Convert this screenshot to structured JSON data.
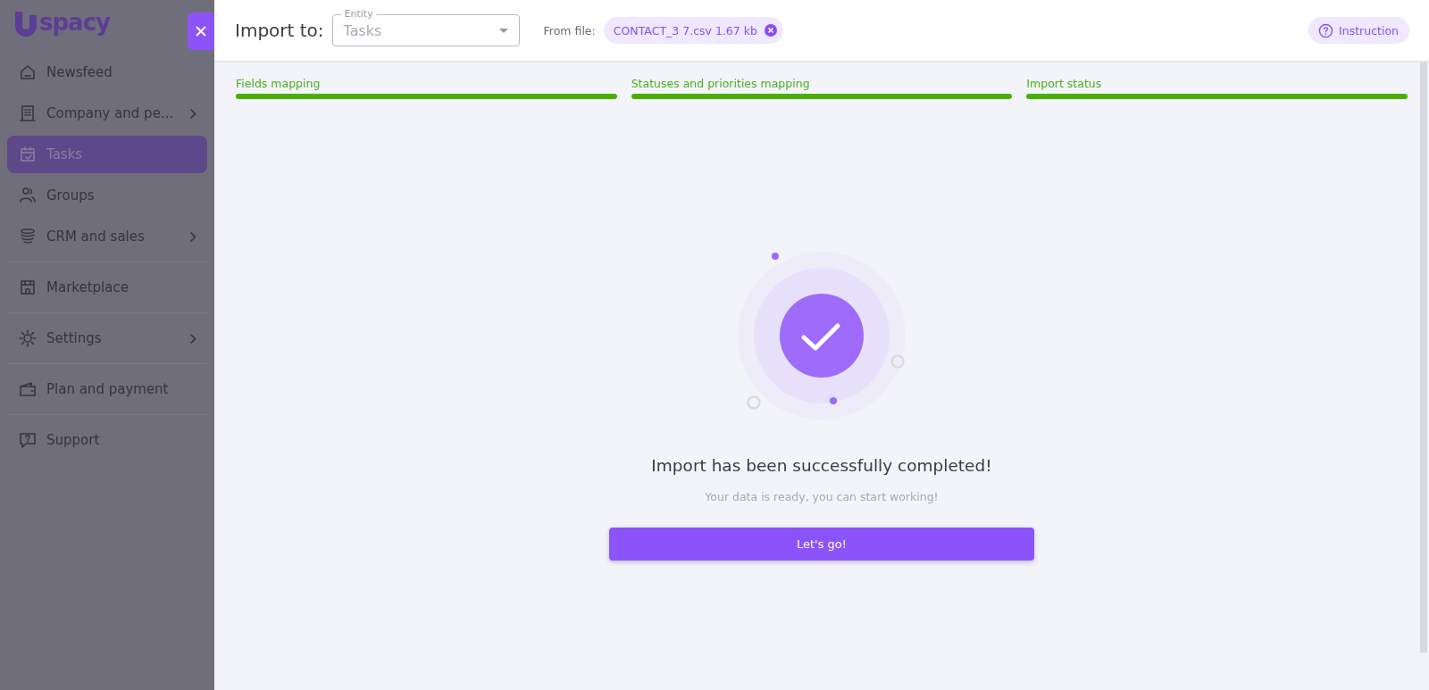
{
  "sidebar": {
    "logo": "spacy",
    "sections": [
      {
        "items": [
          {
            "label": "Newsfeed",
            "selected": false,
            "has_submenu": false
          },
          {
            "label": "Company and pe...",
            "selected": false,
            "has_submenu": true
          },
          {
            "label": "Tasks",
            "selected": true,
            "has_submenu": false
          },
          {
            "label": "Groups",
            "selected": false,
            "has_submenu": false
          },
          {
            "label": "CRM and sales",
            "selected": false,
            "has_submenu": true
          }
        ]
      },
      {
        "items": [
          {
            "label": "Marketplace",
            "selected": false,
            "has_submenu": false
          }
        ]
      },
      {
        "items": [
          {
            "label": "Settings",
            "selected": false,
            "has_submenu": true
          }
        ]
      },
      {
        "items": [
          {
            "label": "Plan and payment",
            "selected": false,
            "has_submenu": false
          }
        ]
      },
      {
        "items": [
          {
            "label": "Support",
            "selected": false,
            "has_submenu": false
          }
        ]
      }
    ]
  },
  "header": {
    "title": "Import to:",
    "entity": {
      "label": "Entity",
      "value": "Tasks"
    },
    "file_label": "From file:",
    "file": "CONTACT_3 7.csv 1.67 kb",
    "instruction": "Instruction"
  },
  "steps": [
    {
      "label": "Fields mapping",
      "done": true
    },
    {
      "label": "Statuses and priorities mapping",
      "done": true
    },
    {
      "label": "Import status",
      "done": true
    }
  ],
  "result": {
    "title": "Import has been successfully completed!",
    "subtitle": "Your data is ready, you can start working!",
    "button": "Let's go!"
  }
}
